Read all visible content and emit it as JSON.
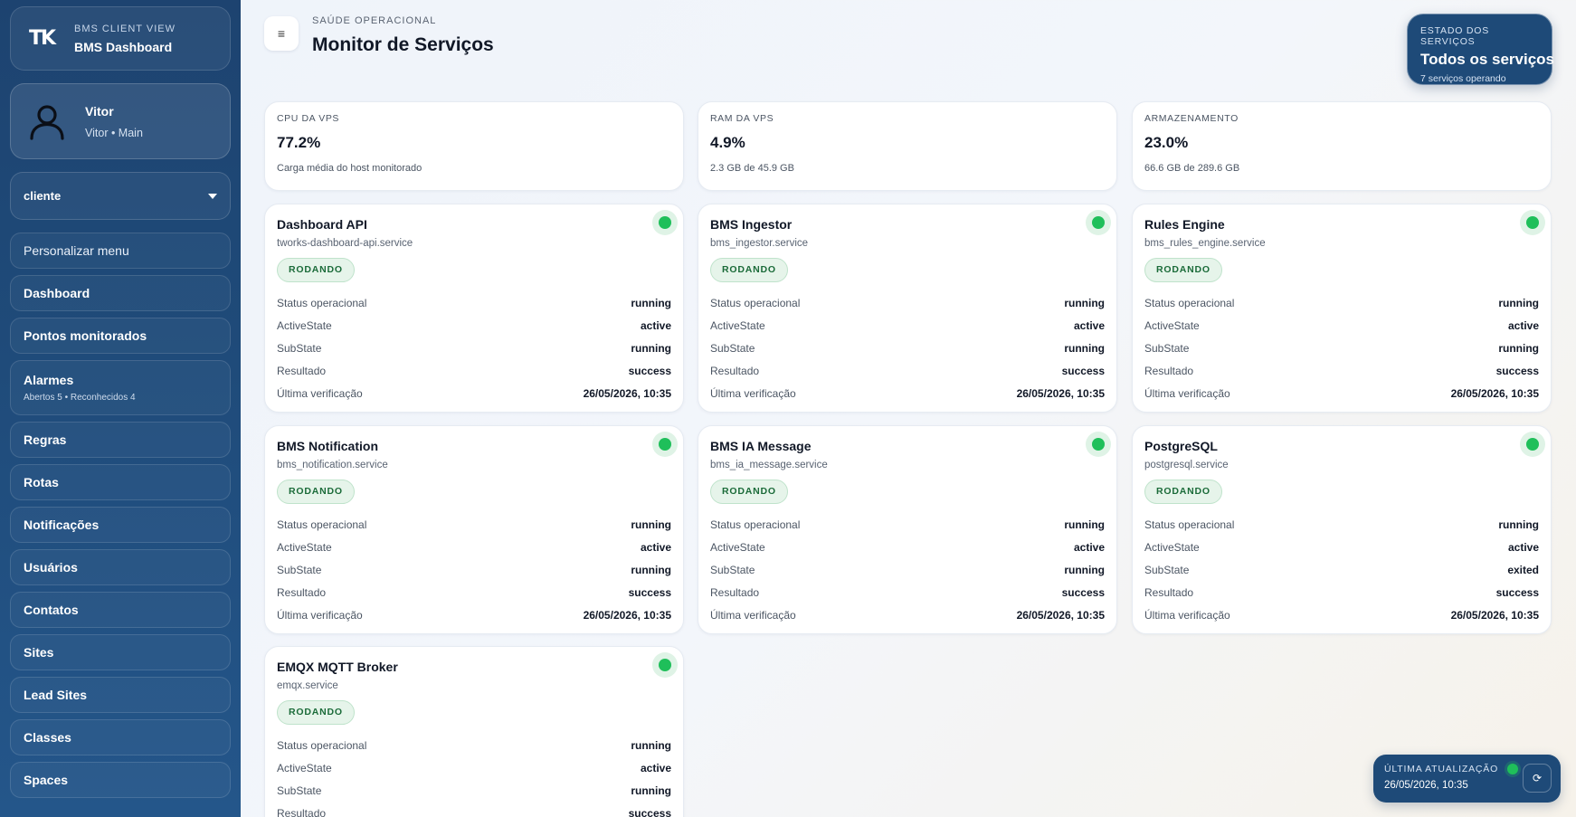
{
  "brand": {
    "logo": "TK",
    "eyebrow": "BMS CLIENT VIEW",
    "name": "BMS Dashboard"
  },
  "user": {
    "name": "Vitor",
    "sub": "Vitor • Main",
    "icon": "user-icon"
  },
  "client_select": {
    "value": "cliente"
  },
  "nav": {
    "customize": "Personalizar menu",
    "dashboard": "Dashboard",
    "pontos": "Pontos monitorados",
    "alarmes": "Alarmes",
    "alarmes_sub": "Abertos 5 • Reconhecidos 4",
    "regras": "Regras",
    "rotas": "Rotas",
    "notificacoes": "Notificações",
    "usuarios": "Usuários",
    "contatos": "Contatos",
    "sites": "Sites",
    "lead_sites": "Lead Sites",
    "classes": "Classes",
    "spaces": "Spaces"
  },
  "header": {
    "menu_icon": "≡",
    "eyebrow": "SAÚDE OPERACIONAL",
    "title": "Monitor de Serviços"
  },
  "services_state": {
    "eyebrow": "ESTADO DOS SERVIÇOS",
    "title": "Todos os serviços",
    "sub": "7 serviços operando"
  },
  "metrics": [
    {
      "label": "CPU DA VPS",
      "value": "77.2%",
      "desc": "Carga média do host monitorado"
    },
    {
      "label": "RAM DA VPS",
      "value": "4.9%",
      "desc": "2.3 GB de 45.9 GB"
    },
    {
      "label": "ARMAZENAMENTO",
      "value": "23.0%",
      "desc": "66.6 GB de 289.6 GB"
    }
  ],
  "labels": {
    "status": "Status operacional",
    "active": "ActiveState",
    "sub": "SubState",
    "result": "Resultado",
    "last": "Última verificação"
  },
  "status_color": "#1fbf5a",
  "services": [
    {
      "name": "Dashboard API",
      "unit": "tworks-dashboard-api.service",
      "badge": "RODANDO",
      "status": "running",
      "active": "active",
      "sub": "running",
      "result": "success",
      "last": "26/05/2026, 10:35"
    },
    {
      "name": "BMS Ingestor",
      "unit": "bms_ingestor.service",
      "badge": "RODANDO",
      "status": "running",
      "active": "active",
      "sub": "running",
      "result": "success",
      "last": "26/05/2026, 10:35"
    },
    {
      "name": "Rules Engine",
      "unit": "bms_rules_engine.service",
      "badge": "RODANDO",
      "status": "running",
      "active": "active",
      "sub": "running",
      "result": "success",
      "last": "26/05/2026, 10:35"
    },
    {
      "name": "BMS Notification",
      "unit": "bms_notification.service",
      "badge": "RODANDO",
      "status": "running",
      "active": "active",
      "sub": "running",
      "result": "success",
      "last": "26/05/2026, 10:35"
    },
    {
      "name": "BMS IA Message",
      "unit": "bms_ia_message.service",
      "badge": "RODANDO",
      "status": "running",
      "active": "active",
      "sub": "running",
      "result": "success",
      "last": "26/05/2026, 10:35"
    },
    {
      "name": "PostgreSQL",
      "unit": "postgresql.service",
      "badge": "RODANDO",
      "status": "running",
      "active": "active",
      "sub": "exited",
      "result": "success",
      "last": "26/05/2026, 10:35"
    },
    {
      "name": "EMQX MQTT Broker",
      "unit": "emqx.service",
      "badge": "RODANDO",
      "status": "running",
      "active": "active",
      "sub": "running",
      "result": "success",
      "last": ""
    }
  ],
  "last_update": {
    "eyebrow": "ÚLTIMA ATUALIZAÇÃO",
    "date": "26/05/2026, 10:35",
    "refresh_icon": "⟳"
  }
}
